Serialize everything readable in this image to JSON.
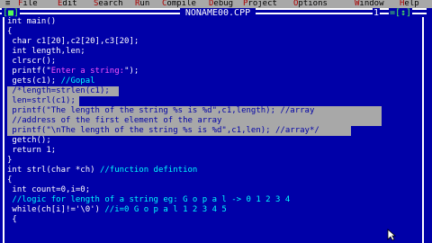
{
  "menu": {
    "items": [
      {
        "hot": "F",
        "rest": "ile"
      },
      {
        "hot": "E",
        "rest": "dit"
      },
      {
        "hot": "S",
        "rest": "earch"
      },
      {
        "hot": "R",
        "rest": "un"
      },
      {
        "hot": "C",
        "rest": "ompile"
      },
      {
        "hot": "D",
        "rest": "ebug"
      },
      {
        "hot": "P",
        "rest": "roject"
      },
      {
        "hot": "O",
        "rest": "ptions"
      },
      {
        "hot": "W",
        "rest": "indow"
      },
      {
        "hot": "H",
        "rest": "elp"
      }
    ]
  },
  "window": {
    "title": "NONAME00.CPP",
    "close_button": "[■]",
    "number": "1",
    "zoom_buttons": "=[↕]"
  },
  "code_lines": [
    {
      "text": "int main()",
      "kind": "normal"
    },
    {
      "text": "{",
      "kind": "normal"
    },
    {
      "text": " char c1[20],c2[20],c3[20];",
      "kind": "normal"
    },
    {
      "text": " int length,len;",
      "kind": "normal"
    },
    {
      "text": " clrscr();",
      "kind": "normal"
    },
    {
      "text": " printf(\"Enter a string:\");",
      "kind": "string"
    },
    {
      "text": " gets(c1); //Gopal",
      "kind": "comment"
    },
    {
      "text": " /*length=strlen(c1);",
      "kind": "selected"
    },
    {
      "text": " len=strl(c1);",
      "kind": "selected"
    },
    {
      "text": " printf(\"The length of the string %s is %d\",c1,length); //array",
      "kind": "selected"
    },
    {
      "text": " //address of the first element of the array",
      "kind": "selected"
    },
    {
      "text": " printf(\"\\nThe length of the string %s is %d\",c1,len); //array*/",
      "kind": "selected"
    },
    {
      "text": " getch();",
      "kind": "normal"
    },
    {
      "text": " return 1;",
      "kind": "normal"
    },
    {
      "text": "}",
      "kind": "normal"
    },
    {
      "text": "int strl(char *ch) //function defintion",
      "kind": "comment2"
    },
    {
      "text": "{",
      "kind": "normal"
    },
    {
      "text": " int count=0,i=0;",
      "kind": "normal"
    },
    {
      "text": " //logic for length of a string eg: G o p a l -> 0 1 2 3 4",
      "kind": "comment_full"
    },
    {
      "text": " while(ch[i]!='\\0') //i=0 G o p a l 1 2 3 4 5",
      "kind": "while"
    },
    {
      "text": " {",
      "kind": "normal"
    }
  ],
  "colors": {
    "background": "#0000a8",
    "menubar": "#a8a8a8",
    "selection": "#a8a8a8",
    "comment": "#00fcfc",
    "string": "#fc54fc",
    "text": "#ffffff"
  }
}
